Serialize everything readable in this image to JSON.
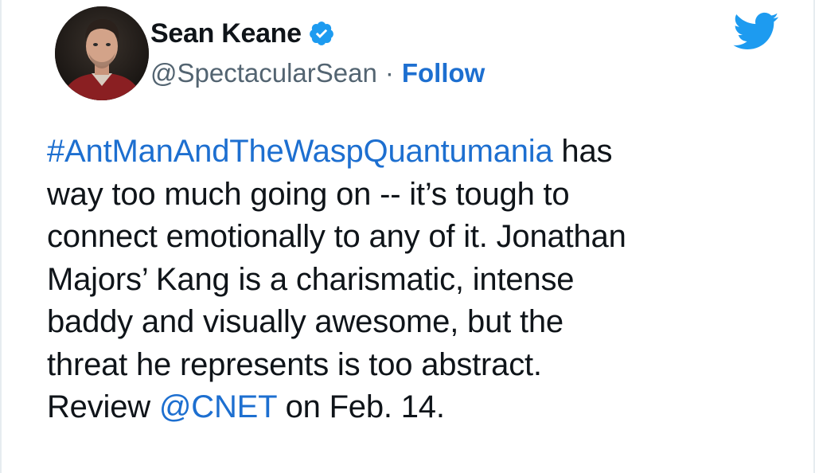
{
  "author": {
    "display_name": "Sean Keane",
    "handle": "@SpectacularSean",
    "separator": "·",
    "follow_label": "Follow",
    "avatar_icon": "profile-photo",
    "verified_icon": "verified-badge-icon"
  },
  "platform": {
    "logo_icon": "twitter-bird-icon",
    "accent_color": "#1d9bf0",
    "link_color": "#1d6fd0"
  },
  "tweet": {
    "hashtag": "#AntManAndTheWaspQuantumania",
    "line1_rest": " has",
    "line2": "way too much going on -- it’s tough to",
    "line3": "connect emotionally to any of it. Jonathan",
    "line4": "Majors’ Kang is a charismatic, intense",
    "line5": "baddy and visually awesome, but the",
    "line6": "threat he represents is too abstract.",
    "line7_prefix": "Review ",
    "mention": "@CNET",
    "line7_suffix": " on Feb. 14."
  }
}
